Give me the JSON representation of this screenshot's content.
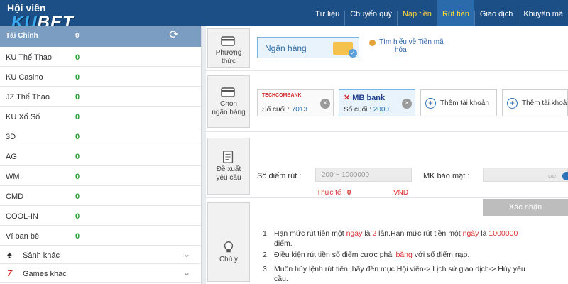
{
  "header": {
    "brand_title": "Hội viên",
    "logo": {
      "part1": "KU",
      "part2": "BET"
    },
    "nav": [
      "Tư liệu",
      "Chuyển quỹ",
      "Nạp tiền",
      "Rút tiền",
      "Giao dịch",
      "Khuyến mã"
    ]
  },
  "sidebar": {
    "wallet_header": {
      "label": "Tài Chính",
      "value": "0"
    },
    "wallets": [
      {
        "name": "KU Thể Thao",
        "amount": "0"
      },
      {
        "name": "KU Casino",
        "amount": "0"
      },
      {
        "name": "JZ Thể Thao",
        "amount": "0"
      },
      {
        "name": "KU Xổ Số",
        "amount": "0"
      },
      {
        "name": "3D",
        "amount": "0"
      },
      {
        "name": "AG",
        "amount": "0"
      },
      {
        "name": "WM",
        "amount": "0"
      },
      {
        "name": "CMD",
        "amount": "0"
      },
      {
        "name": "COOL-IN",
        "amount": "0"
      },
      {
        "name": "Ví ban bè",
        "amount": "0"
      }
    ],
    "menus": [
      {
        "icon": "♠",
        "label": "Sảnh khác"
      },
      {
        "icon": "7",
        "label": "Games khác"
      }
    ]
  },
  "main": {
    "method_section": {
      "tile_label_1": "Phương",
      "tile_label_2": "thức",
      "method": "Ngân hàng",
      "crypto_link_1": "Tìm hiểu về Tiền mã",
      "crypto_link_2": "hóa"
    },
    "bank_section": {
      "tile_label_1": "Chọn",
      "tile_label_2": "ngân hàng",
      "banks": [
        {
          "brand": "TECHCOMBANK",
          "last_label": "Số cuối :",
          "last_digits": "7013"
        },
        {
          "brand": "MB bank",
          "last_label": "Số cuối :",
          "last_digits": "2000"
        }
      ],
      "add_account": "Thêm tài khoản"
    },
    "request_section": {
      "tile_label_1": "Đề xuất",
      "tile_label_2": "yêu cầu",
      "points_label": "Số điểm rút :",
      "points_placeholder": "200 ~ 1000000",
      "password_label": "MK bảo mật :",
      "actual_label": "Thực tế :",
      "actual_value": "0",
      "currency": "VNĐ",
      "confirm": "Xác nhận"
    },
    "notes_section": {
      "tile_label": "Chú ý",
      "notes": [
        {
          "num": "1.",
          "line1_a": "Hạn mức rút tiền một ",
          "line1_b": "ngày",
          "line1_c": " là ",
          "line1_d": "2",
          "line1_e": " lần.Hạn mức rút tiền một ",
          "line1_f": "ngày",
          "line1_g": " là ",
          "line1_h": "1000000",
          "line2": "điểm."
        },
        {
          "num": "2.",
          "line1_a": "Điều kiện rút tiền số điểm cược phải ",
          "line1_b": "bằng",
          "line1_c": " với số điểm nạp."
        },
        {
          "num": "3.",
          "line1": "Muốn hủy lệnh rút tiền, hãy đến mục Hội viên-> Lịch sử giao dịch-> Hủy yêu",
          "line2": "cầu."
        }
      ]
    }
  },
  "colors": {
    "header": "#1c4f86",
    "accent_yellow": "#ffd83a",
    "green": "#2e9e3a",
    "red": "#d33333",
    "link": "#2762a8"
  }
}
